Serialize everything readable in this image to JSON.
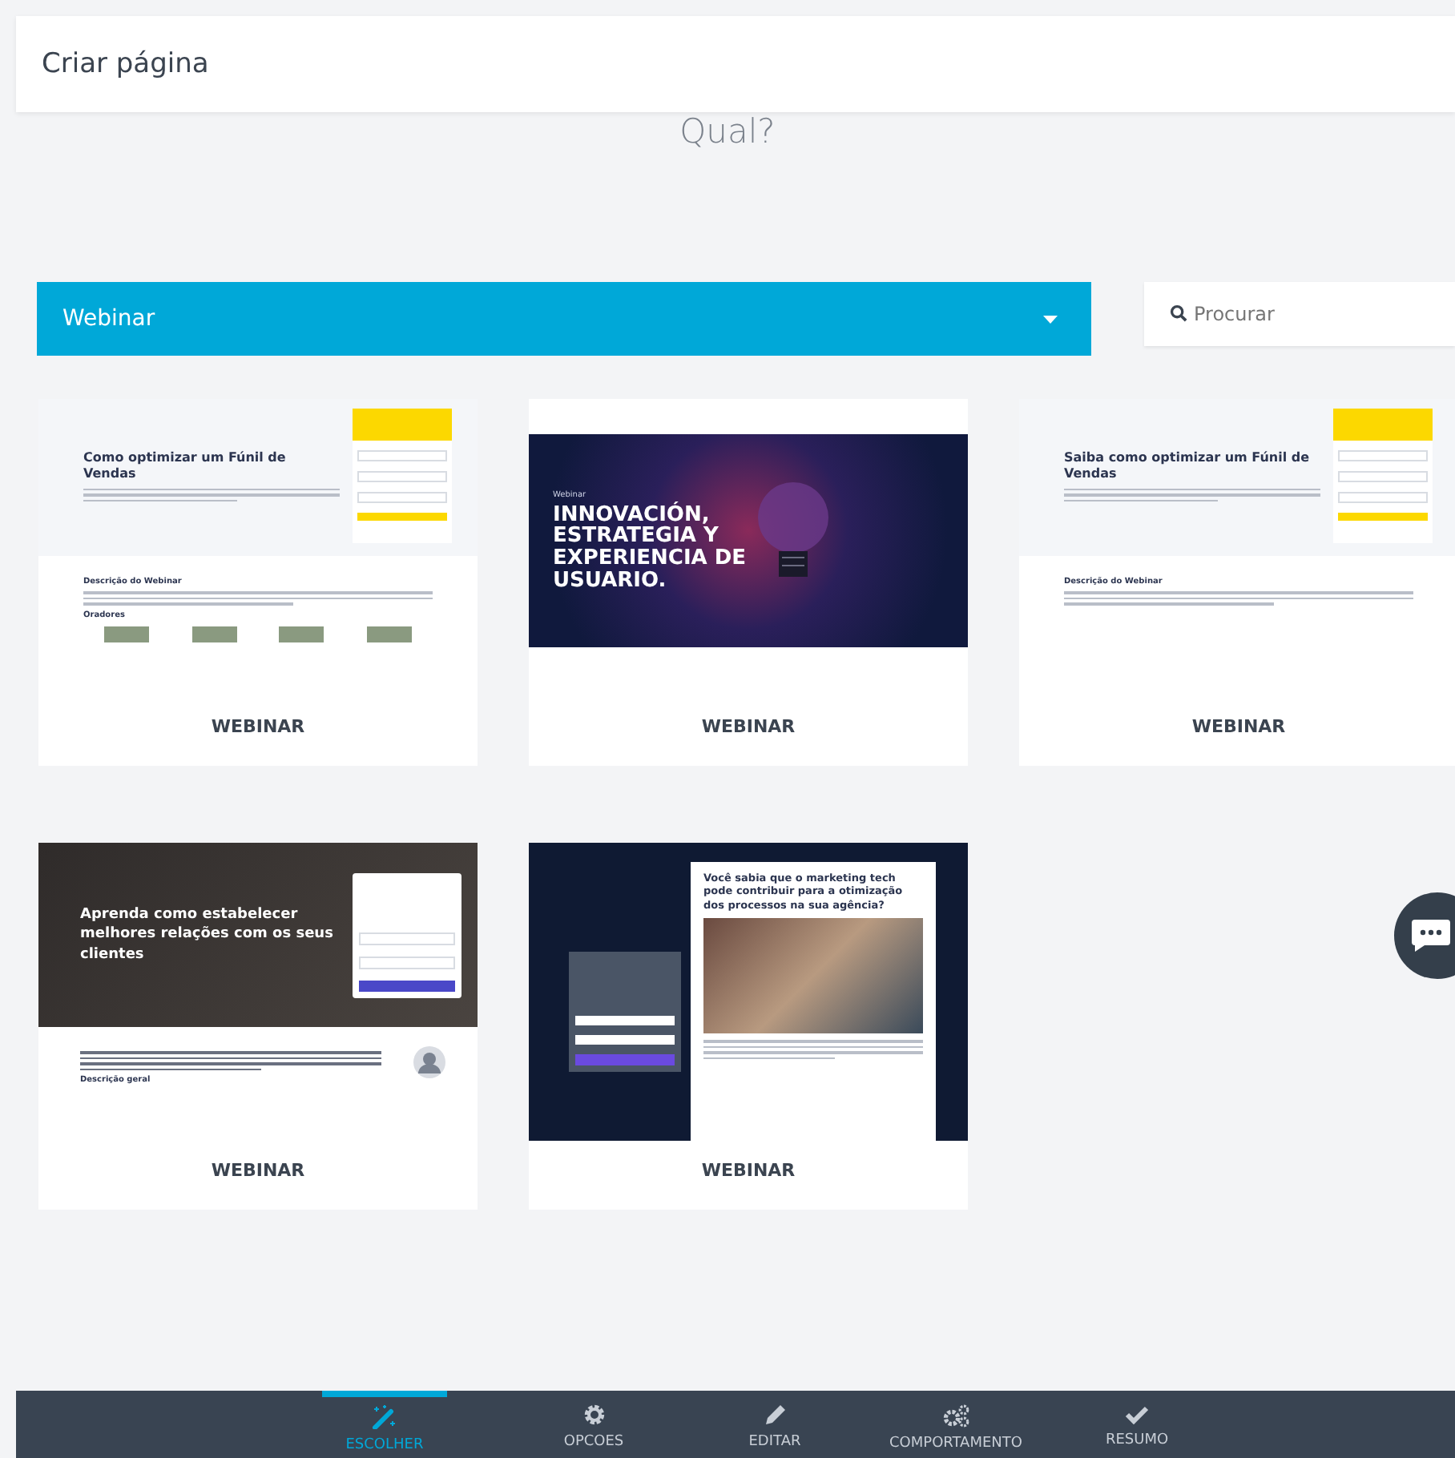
{
  "header": {
    "title": "Criar página"
  },
  "question": "Qual?",
  "category_select": {
    "value": "Webinar"
  },
  "search": {
    "placeholder": "Procurar"
  },
  "templates": [
    {
      "kind": "light-form",
      "headline": "Como optimizar um Fúnil de Vendas",
      "section": "Descrição do Webinar",
      "speakers": "Oradores",
      "label": "WEBINAR"
    },
    {
      "kind": "dark-banner",
      "eyebrow": "Webinar",
      "headline": "INNOVACIÓN, ESTRATEGIA Y EXPERIENCIA DE USUARIO.",
      "label": "WEBINAR"
    },
    {
      "kind": "light-form",
      "headline": "Saiba como optimizar um Fúnil de Vendas",
      "section": "Descrição do Webinar",
      "label": "WEBINAR"
    },
    {
      "kind": "photo-form",
      "headline": "Aprenda como estabelecer melhores relações com os seus clientes",
      "section": "Descrição geral",
      "label": "WEBINAR"
    },
    {
      "kind": "navy-article",
      "headline": "Você sabia que o marketing tech pode contribuir para a otimização dos processos na sua agência?",
      "label": "WEBINAR"
    }
  ],
  "steps": [
    {
      "kind": "wand",
      "label": "ESCOLHER",
      "selected": true
    },
    {
      "kind": "gear",
      "label": "OPCOES",
      "selected": false
    },
    {
      "kind": "pencil",
      "label": "EDITAR",
      "selected": false
    },
    {
      "kind": "gears",
      "label": "COMPORTAMENTO",
      "selected": false
    },
    {
      "kind": "check",
      "label": "RESUMO",
      "selected": false
    }
  ]
}
